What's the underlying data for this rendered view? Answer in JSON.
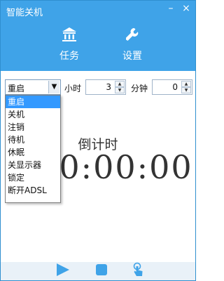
{
  "window": {
    "title": "智能关机",
    "minimize": "–",
    "close": "×"
  },
  "nav": {
    "task_label": "任务",
    "settings_label": "设置",
    "task_icon": "bank-icon",
    "settings_icon": "wrench-icon"
  },
  "controls": {
    "action_selected": "重启",
    "hour_label": "小时",
    "hour_value": "3",
    "minute_label": "分钟",
    "minute_value": "0"
  },
  "dropdown": {
    "items": [
      "重启",
      "关机",
      "注销",
      "待机",
      "休眠",
      "关显示器",
      "锁定",
      "断开ADSL"
    ],
    "selected_index": 0
  },
  "countdown": {
    "label": "倒计时",
    "time": "0:00:00"
  },
  "toolbar": {
    "play_icon": "play-icon",
    "stop_icon": "stop-icon",
    "touch_icon": "touch-icon"
  },
  "colors": {
    "header": "#3fa3e8",
    "accent": "#3399ff",
    "bottom_icons": "#3fa3e8"
  }
}
